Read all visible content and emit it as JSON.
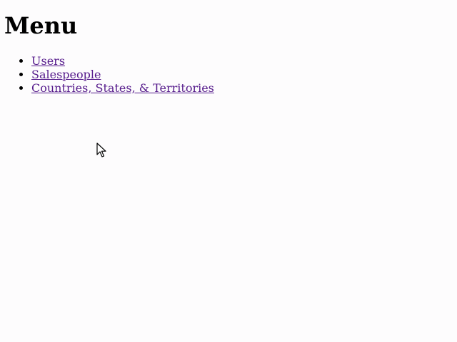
{
  "page": {
    "title": "Menu"
  },
  "menu": {
    "items": [
      {
        "label": "Users"
      },
      {
        "label": "Salespeople"
      },
      {
        "label": "Countries, States, & Territories"
      }
    ]
  },
  "colors": {
    "background": "#fdfcfd",
    "text": "#000000",
    "visited_link": "#551a8b"
  },
  "icons": {
    "cursor": "mouse-pointer-icon"
  }
}
